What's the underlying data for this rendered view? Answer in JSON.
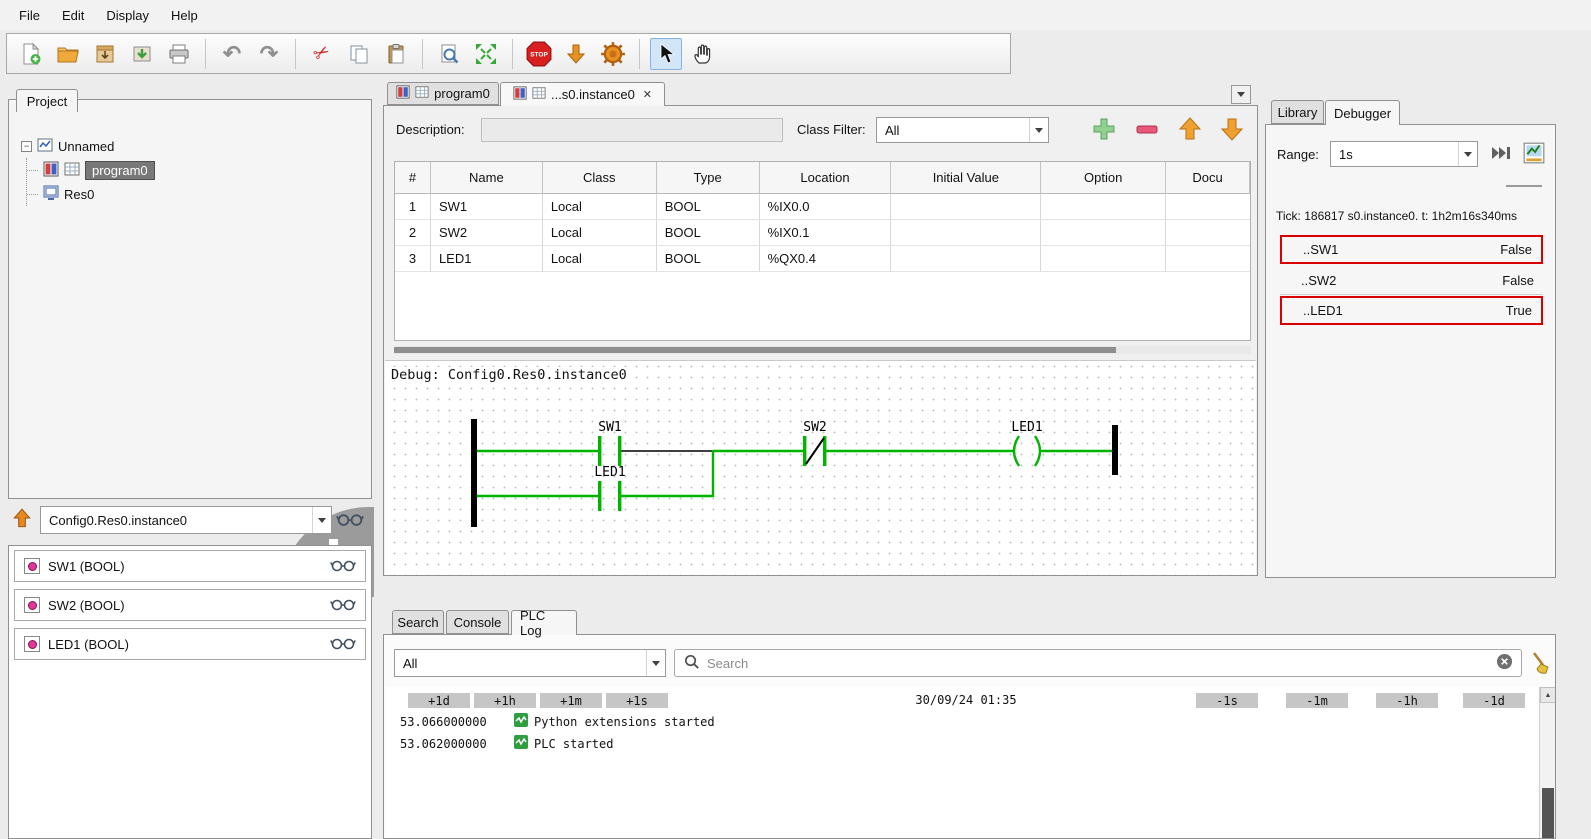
{
  "menu": {
    "items": [
      "File",
      "Edit",
      "Display",
      "Help"
    ]
  },
  "toolbar": {
    "stop_label": "STOP",
    "icons": [
      "new-file",
      "open-project",
      "save",
      "save-as",
      "print",
      "undo",
      "redo",
      "cut",
      "copy",
      "paste",
      "search-in-project",
      "fit-zoom",
      "stop-plc",
      "transfer-program",
      "run-plc",
      "select-tool",
      "pan-tool"
    ]
  },
  "project_panel": {
    "title": "Project",
    "root_label": "Unnamed",
    "items": [
      {
        "label": "program0",
        "selected": true
      },
      {
        "label": "Res0",
        "selected": false
      }
    ]
  },
  "instance_bar": {
    "value": "Config0.Res0.instance0"
  },
  "variable_panel": {
    "items": [
      {
        "label": "SW1 (BOOL)"
      },
      {
        "label": "SW2 (BOOL)"
      },
      {
        "label": "LED1 (BOOL)"
      }
    ]
  },
  "editor": {
    "tabs": [
      {
        "label": "program0"
      },
      {
        "label": "...s0.instance0"
      }
    ],
    "description_label": "Description:",
    "description_value": "",
    "class_filter_label": "Class Filter:",
    "class_filter_value": "All",
    "table": {
      "columns": [
        "#",
        "Name",
        "Class",
        "Type",
        "Location",
        "Initial Value",
        "Option",
        "Docu"
      ],
      "rows": [
        {
          "num": "1",
          "name": "SW1",
          "class": "Local",
          "type": "BOOL",
          "location": "%IX0.0",
          "initial": "",
          "option": "",
          "doc": ""
        },
        {
          "num": "2",
          "name": "SW2",
          "class": "Local",
          "type": "BOOL",
          "location": "%IX0.1",
          "initial": "",
          "option": "",
          "doc": ""
        },
        {
          "num": "3",
          "name": "LED1",
          "class": "Local",
          "type": "BOOL",
          "location": "%QX0.4",
          "initial": "",
          "option": "",
          "doc": ""
        }
      ]
    },
    "debug_label": "Debug: Config0.Res0.instance0",
    "ladder": {
      "contact1": "SW1",
      "contact2": "SW2",
      "coil": "LED1",
      "parallel_contact": "LED1",
      "powered_color": "#00b400",
      "unpowered_color": "#000000"
    }
  },
  "debugger_panel": {
    "tabs": [
      "Library",
      "Debugger"
    ],
    "active_tab": "Debugger",
    "range_label": "Range:",
    "range_value": "1s",
    "tick_text": "Tick: 186817 s0.instance0. t: 1h2m16s340ms",
    "highlight_color": "#d80000",
    "watches": [
      {
        "name": "..SW1",
        "value": "False",
        "highlighted": true
      },
      {
        "name": "..SW2",
        "value": "False",
        "highlighted": false
      },
      {
        "name": "..LED1",
        "value": "True",
        "highlighted": true
      }
    ]
  },
  "bottom_panel": {
    "tabs": [
      "Search",
      "Console",
      "PLC Log"
    ],
    "active_tab": "PLC Log",
    "filter_value": "All",
    "search_placeholder": "Search",
    "plus_buttons": [
      "+1d",
      "+1h",
      "+1m",
      "+1s"
    ],
    "timestamp": "30/09/24 01:35",
    "minus_buttons": [
      "-1s",
      "-1m",
      "-1h",
      "-1d"
    ],
    "log_entries": [
      {
        "time": "53.066000000",
        "message": "Python extensions started"
      },
      {
        "time": "53.062000000",
        "message": "PLC started"
      }
    ]
  }
}
